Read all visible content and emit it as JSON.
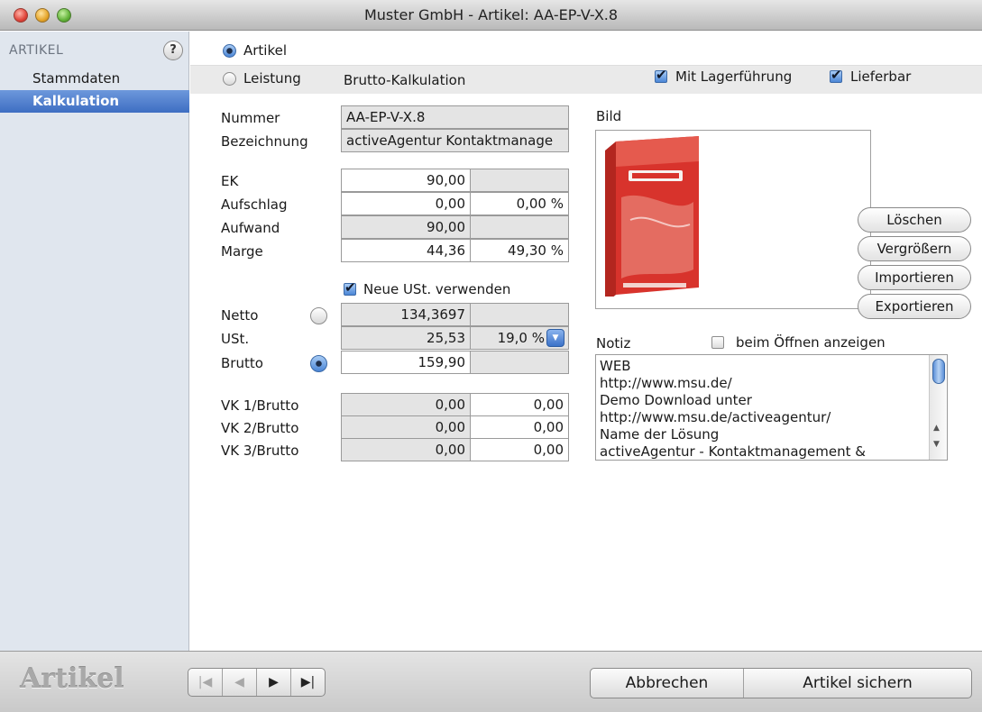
{
  "window": {
    "title": "Muster GmbH - Artikel: AA-EP-V-X.8"
  },
  "sidebar": {
    "header": "ARTIKEL",
    "help_icon": "?",
    "items": [
      {
        "label": "Stammdaten",
        "selected": false
      },
      {
        "label": "Kalkulation",
        "selected": true
      }
    ]
  },
  "type_selector": {
    "artikel_label": "Artikel",
    "artikel_selected": true,
    "leistung_label": "Leistung",
    "leistung_selected": false,
    "mode_label": "Brutto-Kalkulation"
  },
  "flags": {
    "lager_label": "Mit Lagerführung",
    "lager_checked": true,
    "lieferbar_label": "Lieferbar",
    "lieferbar_checked": true
  },
  "form": {
    "nummer_label": "Nummer",
    "nummer_value": "AA-EP-V-X.8",
    "bezeichnung_label": "Bezeichnung",
    "bezeichnung_value": "activeAgentur Kontaktmanage",
    "ek_label": "EK",
    "ek_value": "90,00",
    "aufschlag_label": "Aufschlag",
    "aufschlag_value": "0,00",
    "aufschlag_percent": "0,00 %",
    "aufwand_label": "Aufwand",
    "aufwand_value": "90,00",
    "marge_label": "Marge",
    "marge_value": "44,36",
    "marge_percent": "49,30 %",
    "neue_ust_label": "Neue USt. verwenden",
    "neue_ust_checked": true,
    "netto_label": "Netto",
    "netto_value": "134,3697",
    "ust_label": "USt.",
    "ust_value": "25,53",
    "ust_rate": "19,0 %",
    "brutto_label": "Brutto",
    "brutto_value": "159,90",
    "vk": [
      {
        "label": "VK 1/Brutto",
        "value1": "0,00",
        "value2": "0,00"
      },
      {
        "label": "VK 2/Brutto",
        "value1": "0,00",
        "value2": "0,00"
      },
      {
        "label": "VK 3/Brutto",
        "value1": "0,00",
        "value2": "0,00"
      }
    ]
  },
  "bild": {
    "label": "Bild",
    "buttons": [
      "Löschen",
      "Vergrößern",
      "Importieren",
      "Exportieren"
    ]
  },
  "notiz": {
    "label": "Notiz",
    "show_on_open_label": "beim Öffnen anzeigen",
    "show_on_open_checked": false,
    "lines": [
      "WEB",
      "http://www.msu.de/",
      "Demo Download unter",
      "http://www.msu.de/activeagentur/",
      "Name der Lösung",
      "activeAgentur - Kontaktmanagement &"
    ]
  },
  "bottom": {
    "title": "Artikel",
    "nav": [
      "|◀",
      "◀",
      "▶",
      "▶|"
    ],
    "cancel_label": "Abbrechen",
    "save_label": "Artikel sichern"
  },
  "colors": {
    "selection": "#3e6ec2",
    "sidebar_bg": "#e0e6ee",
    "product_box": "#d8332c"
  }
}
